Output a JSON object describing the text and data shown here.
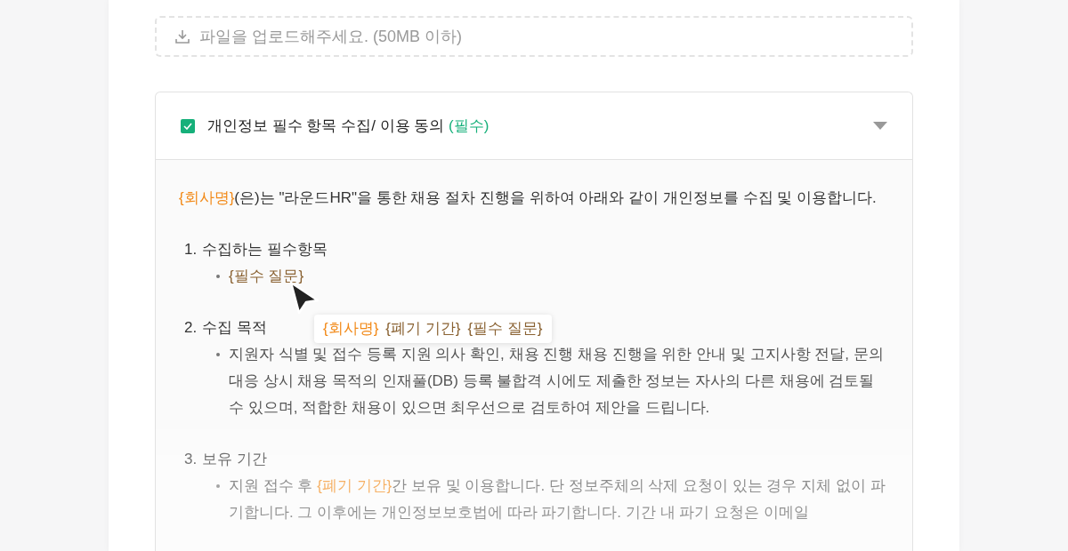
{
  "upload": {
    "placeholder": "파일을 업로드해주세요. (50MB 이하)"
  },
  "consent": {
    "checked": true,
    "expanded": true,
    "label": "개인정보 필수 항목 수집/ 이용 동의",
    "required_label": "(필수)"
  },
  "intro": [
    {
      "kind": "company",
      "text": "{회사명}"
    },
    {
      "kind": "plain",
      "text": "(은)는 \"라운드HR\"을 통한 채용 절차 진행을 위하여 아래와 같이 개인정보를 수집 및 이용합니다."
    }
  ],
  "sections": [
    {
      "number": "1.",
      "title": "수집하는 필수항목",
      "items": [
        [
          {
            "kind": "variable",
            "text": "{필수 질문}"
          }
        ]
      ]
    },
    {
      "number": "2.",
      "title": "수집 목적",
      "items": [
        [
          {
            "kind": "plain",
            "text": "지원자 식별 및 접수 등록 지원 의사 확인, 채용 진행 채용 진행을 위한 안내 및 고지사항 전달, 문의 대응 상시 채용 목적의 인재풀(DB) 등록 불합격 시에도 제출한 정보는 자사의 다른 채용에 검토될 수 있으며, 적합한 채용이 있으면 최우선으로 검토하여 제안을 드립니다."
          }
        ]
      ]
    },
    {
      "number": "3.",
      "title": "보유 기간",
      "items": [
        [
          {
            "kind": "plain",
            "text": "지원 접수 후 "
          },
          {
            "kind": "company",
            "text": "{폐기 기간}"
          },
          {
            "kind": "plain",
            "text": "간 보유 및 이용합니다. 단 정보주체의 삭제 요청이 있는 경우 지체 없이 파기합니다. 그 이후에는 개인정보보호법에 따라 파기합니다. 기간 내 파기 요청은 이메일"
          }
        ]
      ]
    }
  ],
  "tooltip": {
    "chips": [
      {
        "kind": "company",
        "text": "{회사명}"
      },
      {
        "kind": "variable",
        "text": "{폐기 기간}"
      },
      {
        "kind": "variable",
        "text": "{필수 질문}"
      }
    ]
  }
}
